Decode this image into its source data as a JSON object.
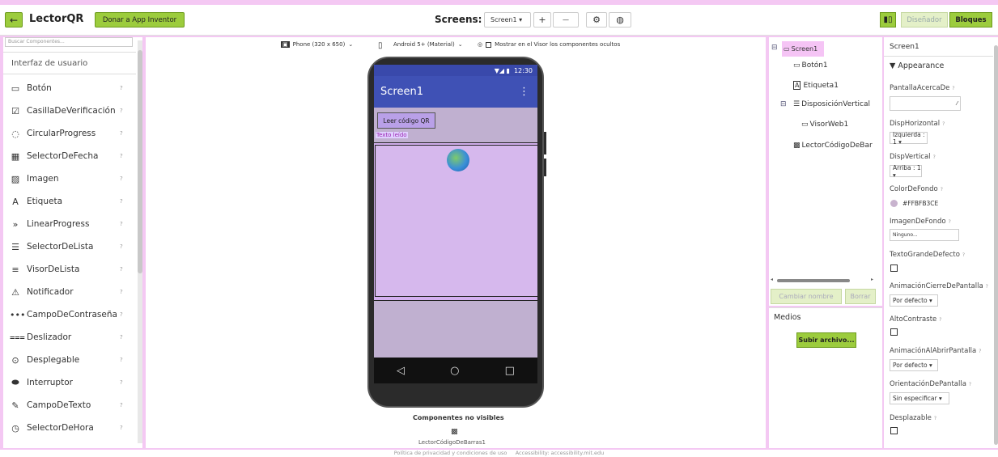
{
  "header": {
    "back_icon": "←",
    "app_name": "LectorQR",
    "donate_label": "Donar a App Inventor",
    "screens_label": "Screens:",
    "screen_select": "Screen1 ▾",
    "add_screen": "+",
    "remove_screen": "—",
    "designer_label": "Diseñador",
    "blocks_label": "Bloques",
    "accent_color": "#9ccc3d"
  },
  "palette": {
    "search_placeholder": "Buscar Componentes...",
    "category": "Interfaz de usuario",
    "help_glyph": "?",
    "items": [
      {
        "label": "Botón",
        "icon": "▭"
      },
      {
        "label": "CasillaDeVerificación",
        "icon": "☑"
      },
      {
        "label": "CircularProgress",
        "icon": "◌"
      },
      {
        "label": "SelectorDeFecha",
        "icon": "▦"
      },
      {
        "label": "Imagen",
        "icon": "▨"
      },
      {
        "label": "Etiqueta",
        "icon": "A"
      },
      {
        "label": "LinearProgress",
        "icon": "»"
      },
      {
        "label": "SelectorDeLista",
        "icon": "☰"
      },
      {
        "label": "VisorDeLista",
        "icon": "≡"
      },
      {
        "label": "Notificador",
        "icon": "⚠"
      },
      {
        "label": "CampoDeContraseña",
        "icon": "•••"
      },
      {
        "label": "Deslizador",
        "icon": "⩶"
      },
      {
        "label": "Desplegable",
        "icon": "⊙"
      },
      {
        "label": "Interruptor",
        "icon": "⬬"
      },
      {
        "label": "CampoDeTexto",
        "icon": "✎"
      },
      {
        "label": "SelectorDeHora",
        "icon": "◷"
      }
    ]
  },
  "viewer": {
    "device_select": "Phone (320 x 650)",
    "theme_select": "Android 5+ (Material)",
    "show_hidden_label": "Mostrar en el Visor los componentes ocultos",
    "status_time": "12:30",
    "status_icons": "▼◢ ▮",
    "screen_title": "Screen1",
    "menu_icon": "⋮",
    "button_text": "Leer código QR",
    "label_text": "Texto leído",
    "nav_back": "◁",
    "nav_home": "○",
    "nav_recent": "□",
    "nonvisible_title": "Componentes no visibles",
    "nonvisible_item": "LectorCódigoDeBarras1",
    "nonvisible_icon": "▩"
  },
  "tree": {
    "screen": "Screen1",
    "items": [
      {
        "label": "Botón1",
        "icon": "▭"
      },
      {
        "label": "Etiqueta1",
        "icon": "A"
      },
      {
        "label": "DisposiciónVertical",
        "icon": "☰"
      },
      {
        "label": "VisorWeb1",
        "icon": "▭"
      },
      {
        "label": "LectorCódigoDeBar",
        "icon": "▩"
      }
    ],
    "collapse_glyph": "⊟",
    "rename_label": "Cambiar nombre",
    "delete_label": "Borrar"
  },
  "media": {
    "title": "Medios",
    "upload_label": "Subir archivo..."
  },
  "properties": {
    "component": "Screen1",
    "section": "▼ Appearance",
    "help_glyph": "?",
    "about_label": "PantallaAcercaDe",
    "halign_label": "DispHorizontal",
    "halign_value": "Izquierda : 1 ▾",
    "valign_label": "DispVertical",
    "valign_value": "Arriba : 1 ▾",
    "bgcolor_label": "ColorDeFondo",
    "bgcolor_value": "#FFBFB3CE",
    "bgimage_label": "ImagenDeFondo",
    "bgimage_value": "Ninguno...",
    "bigtext_label": "TextoGrandeDefecto",
    "closeanim_label": "AnimaciónCierreDePantalla",
    "closeanim_value": "Por defecto ▾",
    "contrast_label": "AltoContraste",
    "openanim_label": "AnimaciónAlAbrirPantalla",
    "openanim_value": "Por defecto ▾",
    "orientation_label": "OrientaciónDePantalla",
    "orientation_value": "Sin especificar ▾",
    "scrollable_label": "Desplazable"
  },
  "footer": {
    "privacy": "Política de privacidad y condiciones de uso",
    "accessibility": "Accessibility: accessibility.mit.edu"
  }
}
